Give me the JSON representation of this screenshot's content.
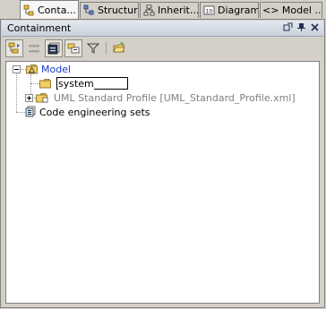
{
  "tabs": [
    {
      "label": "Conta...",
      "icon": "containment-tree-icon",
      "active": true
    },
    {
      "label": "Structure",
      "icon": "structure-icon",
      "active": false
    },
    {
      "label": "Inherit...",
      "icon": "inheritance-icon",
      "active": false
    },
    {
      "label": "Diagrams",
      "icon": "diagrams-icon",
      "active": false
    },
    {
      "label": "<> Model ...",
      "icon": "model-extensions-icon",
      "active": false
    }
  ],
  "panel": {
    "title": "Containment",
    "controls": [
      "undock-icon",
      "pin-icon",
      "close-icon"
    ]
  },
  "toolbar": {
    "buttons": [
      {
        "name": "expand-all-button",
        "icon": "expand-all-icon",
        "pressed": true
      },
      {
        "name": "collapse-all-button",
        "icon": "collapse-all-icon",
        "pressed": false
      },
      {
        "name": "show-properties-button",
        "icon": "show-properties-icon",
        "pressed": true
      },
      {
        "name": "show-elements-button",
        "icon": "show-elements-icon",
        "pressed": true
      },
      {
        "name": "filter-button",
        "icon": "filter-icon",
        "pressed": false
      },
      {
        "name": "open-package-button",
        "icon": "open-package-icon",
        "pressed": false
      }
    ]
  },
  "tree": {
    "model": {
      "label": "Model",
      "color": "#1a3cc8",
      "expanded": true
    },
    "system": {
      "label": "system",
      "editing": true
    },
    "profile": {
      "label": "UML Standard Profile [UML_Standard_Profile.xml]",
      "color": "#808080",
      "expanded": false
    },
    "code_sets": {
      "label": "Code engineering sets"
    }
  }
}
